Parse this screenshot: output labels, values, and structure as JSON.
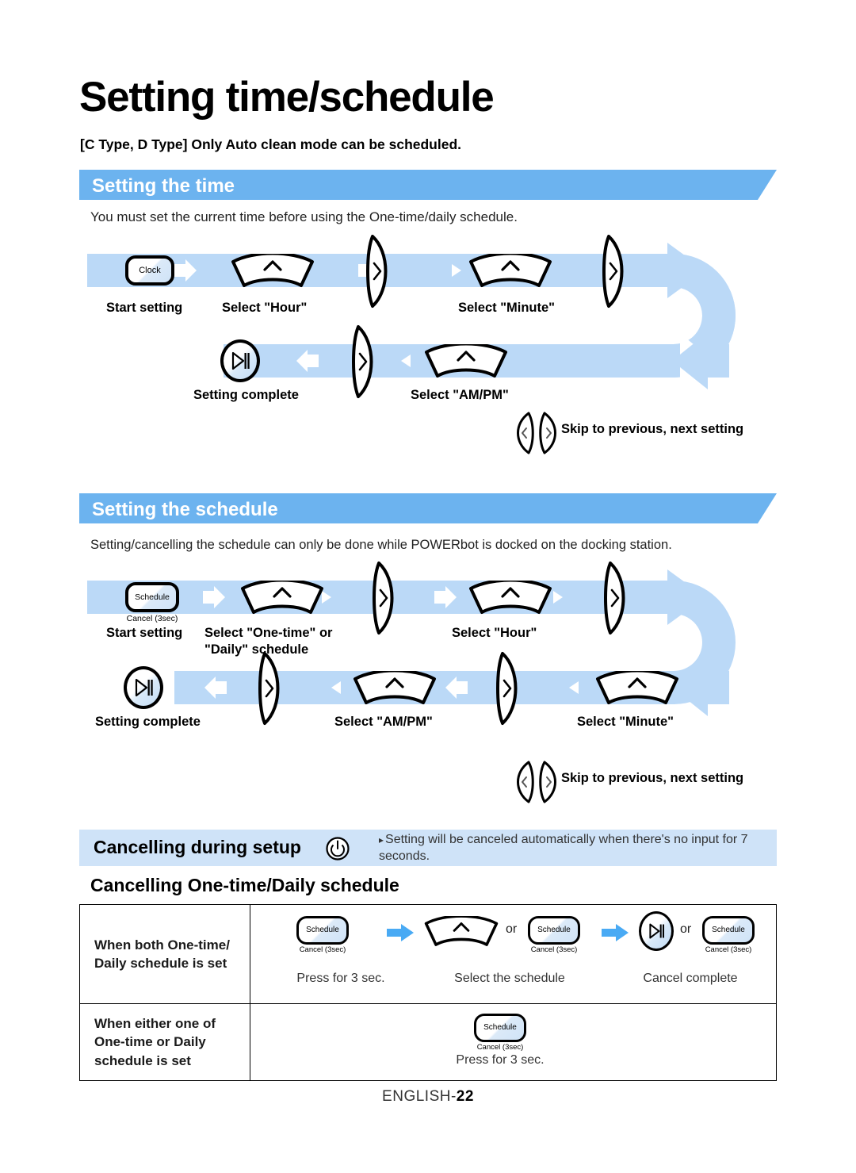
{
  "document": {
    "title": "Setting time/schedule",
    "subtitle": "[C Type, D Type] Only Auto clean mode can be scheduled.",
    "footer_prefix": "ENGLISH-",
    "footer_page": "22"
  },
  "section_time": {
    "heading": "Setting the time",
    "intro": "You must set the current time before using the One-time/daily schedule.",
    "steps_row1": [
      {
        "label": "Start setting",
        "icon": "clock-key",
        "icon_text": "Clock"
      },
      {
        "label": "Select \"Hour\"",
        "icon": "arc-key"
      },
      {
        "label": "",
        "icon": "skip-next-key"
      },
      {
        "label": "Select \"Minute\"",
        "icon": "arc-key"
      },
      {
        "label": "",
        "icon": "skip-next-key"
      }
    ],
    "steps_row2": [
      {
        "label": "Setting complete",
        "icon": "play-pause-key"
      },
      {
        "label": "",
        "icon": "skip-next-key"
      },
      {
        "label": "Select \"AM/PM\"",
        "icon": "arc-key"
      }
    ],
    "skip_legend": "Skip to previous, next setting"
  },
  "section_schedule": {
    "heading": "Setting the schedule",
    "intro": "Setting/cancelling the schedule can only be done while POWERbot is docked on the docking station.",
    "steps_row1": [
      {
        "label": "Start setting",
        "icon": "schedule-key",
        "icon_text": "Schedule",
        "icon_sub": "Cancel (3sec)"
      },
      {
        "label": "Select \"One-time\" or\n\"Daily\" schedule",
        "icon": "arc-key"
      },
      {
        "label": "",
        "icon": "skip-next-key"
      },
      {
        "label": "Select \"Hour\"",
        "icon": "arc-key"
      },
      {
        "label": "",
        "icon": "skip-next-key"
      }
    ],
    "steps_row2": [
      {
        "label": "Setting complete",
        "icon": "play-pause-key"
      },
      {
        "label": "",
        "icon": "skip-next-key"
      },
      {
        "label": "Select \"AM/PM\"",
        "icon": "arc-key"
      },
      {
        "label": "",
        "icon": "skip-next-key"
      },
      {
        "label": "Select \"Minute\"",
        "icon": "arc-key"
      }
    ],
    "skip_legend": "Skip to previous, next setting"
  },
  "cancelling": {
    "band_title": "Cancelling during setup",
    "band_icon": "power-icon",
    "band_note": "Setting will be canceled automatically when there's no input for 7 seconds.",
    "sub_heading": "Cancelling One-time/Daily schedule",
    "table": {
      "rows": [
        {
          "label": "When both One-time/\nDaily schedule is set",
          "captions": [
            "Press for 3 sec.",
            "Select the schedule",
            "Cancel complete"
          ],
          "or_label": "or",
          "key_text": "Schedule",
          "key_sub": "Cancel (3sec)"
        },
        {
          "label": "When either one of\nOne-time or Daily\nschedule is set",
          "captions": [
            "Press for 3 sec."
          ],
          "key_text": "Schedule",
          "key_sub": "Cancel (3sec)"
        }
      ]
    }
  },
  "colors": {
    "header_blue": "#6cb3ef",
    "ribbon_blue": "#bbd9f7",
    "band_blue": "#cfe3f8",
    "ink": "#000000"
  }
}
